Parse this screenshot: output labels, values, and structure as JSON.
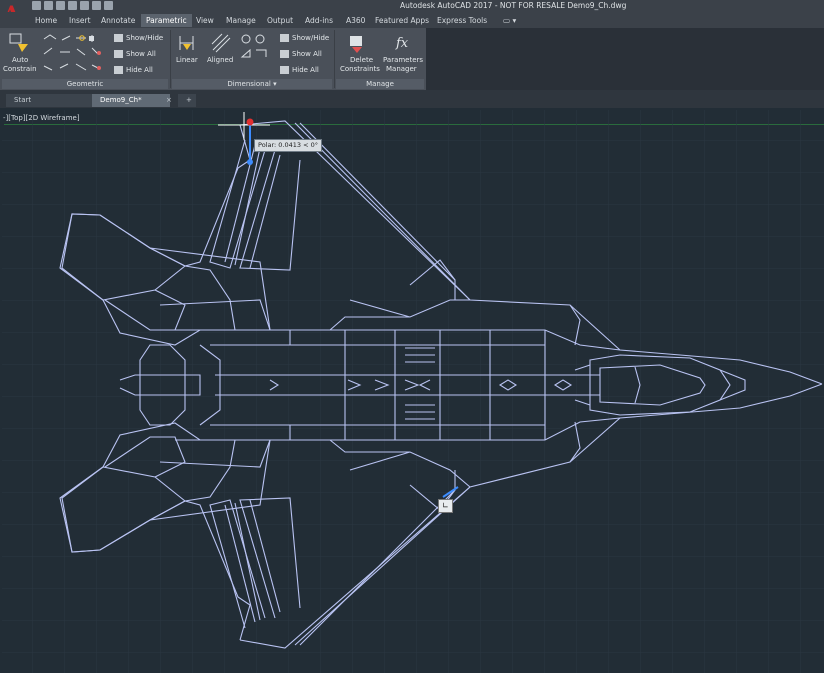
{
  "app": {
    "logo_letter": "A",
    "title": "Autodesk AutoCAD 2017 - NOT FOR RESALE    Demo9_Ch.dwg"
  },
  "ribbon_tabs": [
    "Home",
    "Insert",
    "Annotate",
    "Parametric",
    "View",
    "Manage",
    "Output",
    "Add-ins",
    "A360",
    "Featured Apps",
    "Express Tools"
  ],
  "active_ribbon_tab": "Parametric",
  "geometric_panel": {
    "label": "Geometric",
    "auto_constrain_line1": "Auto",
    "auto_constrain_line2": "Constrain",
    "show_hide": "Show/Hide",
    "show_all": "Show All",
    "hide_all": "Hide All"
  },
  "dimensional_panel": {
    "label": "Dimensional",
    "linear": "Linear",
    "aligned": "Aligned",
    "show_hide": "Show/Hide",
    "show_all": "Show All",
    "hide_all": "Hide All"
  },
  "manage_panel": {
    "label": "Manage",
    "delete_line1": "Delete",
    "delete_line2": "Constraints",
    "params_line1": "Parameters",
    "params_line2": "Manager",
    "fx_glyph": "fx"
  },
  "doc_tabs": {
    "start": "Start",
    "active": "Demo9_Ch*",
    "new_tab": "+",
    "close_glyph": "×"
  },
  "viewport": {
    "label": "-][Top][2D Wireframe]"
  },
  "tooltip": {
    "text": "Polar: 0.0413 < 0°"
  },
  "colors": {
    "background": "#222d36",
    "linework": "#b9c3f2",
    "ribbon": "#4a5059",
    "accent": "#c8282a"
  }
}
